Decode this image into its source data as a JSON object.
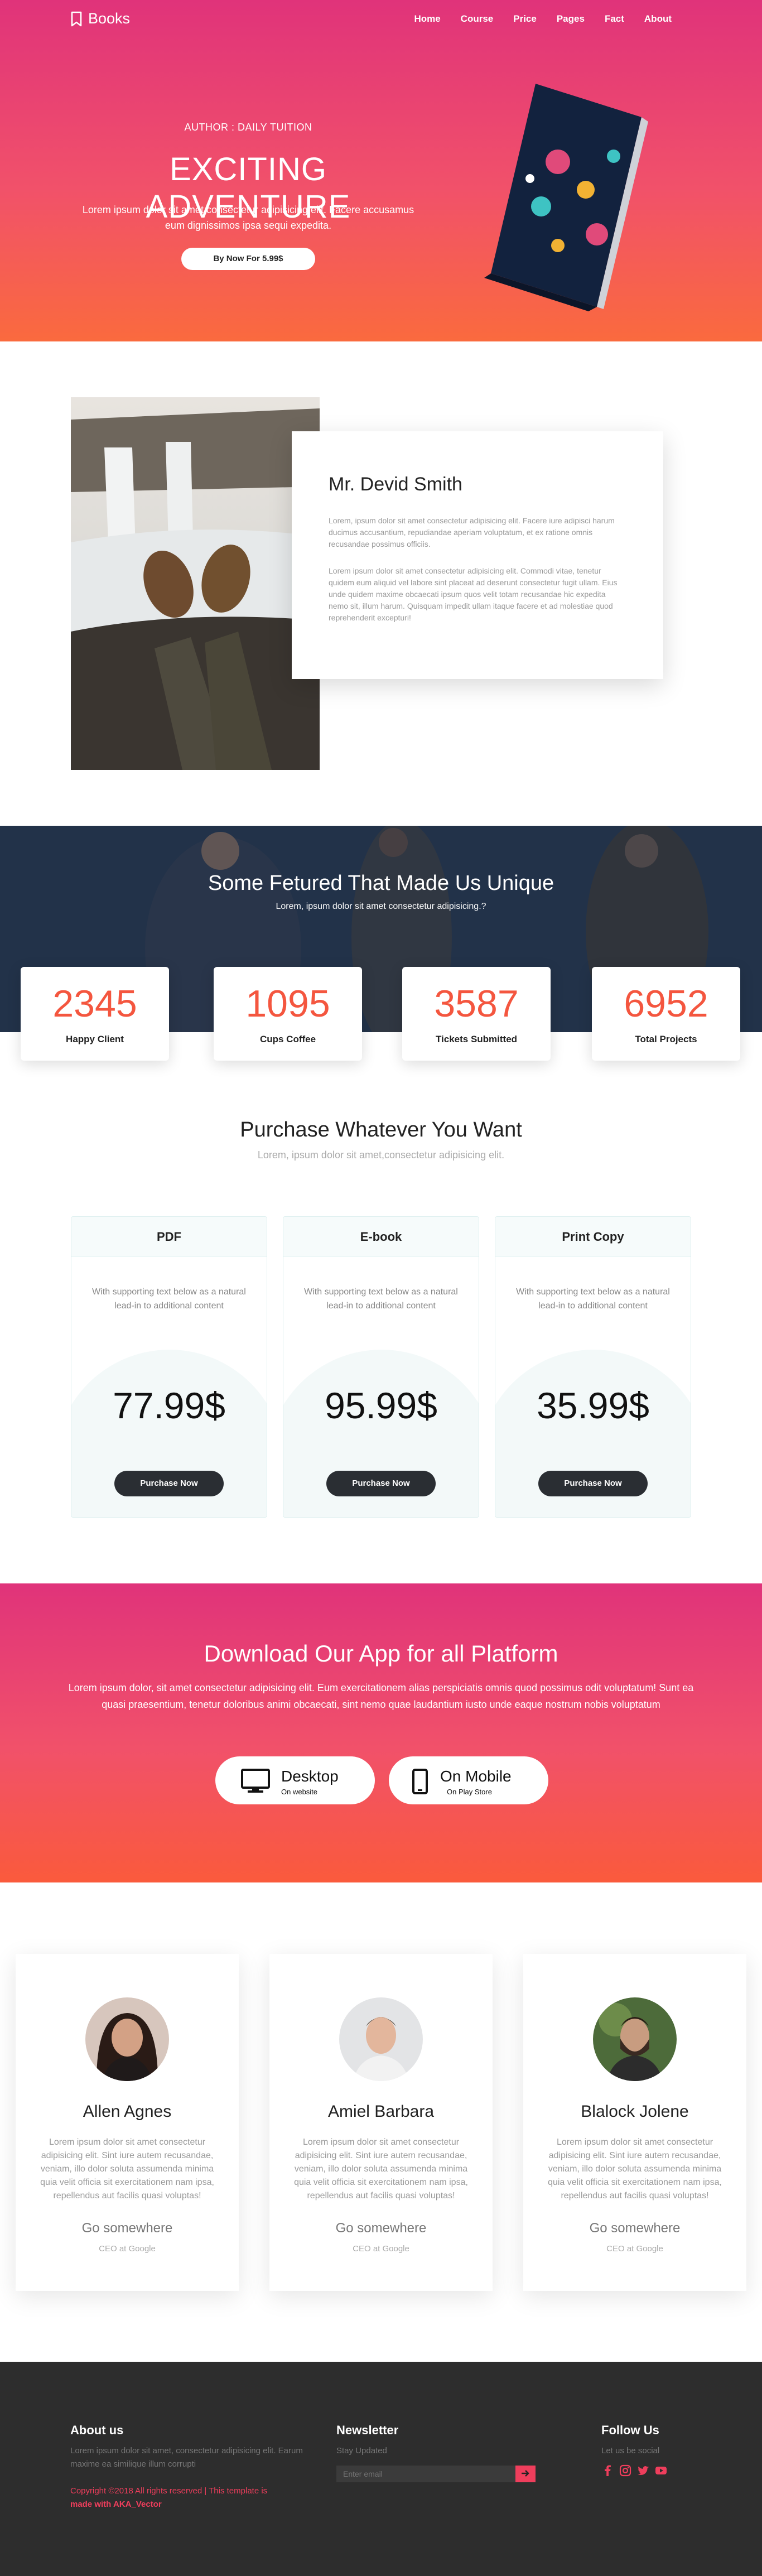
{
  "nav": {
    "brand": "Books",
    "items": [
      "Home",
      "Course",
      "Price",
      "Pages",
      "Fact",
      "About"
    ]
  },
  "hero": {
    "author": "AUTHOR : DAILY TUITION",
    "title": "EXCITING ADVENTURE",
    "text": "Lorem ipsum dolor sit amet consectetur adipisicing elit. Facere accusamus eum dignissimos ipsa sequi expedita.",
    "button": "By Now For 5.99$"
  },
  "profile": {
    "name": "Mr. Devid Smith",
    "para1": "Lorem, ipsum dolor sit amet consectetur adipisicing elit. Facere iure adipisci harum ducimus accusantium, repudiandae aperiam voluptatum, et ex ratione omnis recusandae possimus officiis.",
    "para2": "Lorem ipsum dolor sit amet consectetur adipisicing elit. Commodi vitae, tenetur quidem eum aliquid vel labore sint placeat ad deserunt consectetur fugit ullam. Eius unde quidem maxime obcaecati ipsum quos velit totam recusandae hic expedita nemo sit, illum harum. Quisquam impedit ullam itaque facere et ad molestiae quod reprehenderit excepturi!"
  },
  "featured": {
    "title": "Some Fetured That Made Us Unique",
    "subtitle": "Lorem, ipsum dolor sit amet consectetur adipisicing.?",
    "stats": [
      {
        "value": "2345",
        "label": "Happy Client"
      },
      {
        "value": "1095",
        "label": "Cups Coffee"
      },
      {
        "value": "3587",
        "label": "Tickets Submitted"
      },
      {
        "value": "6952",
        "label": "Total Projects"
      }
    ]
  },
  "purchase": {
    "title": "Purchase Whatever You Want",
    "subtitle": "Lorem, ipsum dolor sit amet,consectetur adipisicing elit.",
    "plans": [
      {
        "name": "PDF",
        "desc": "With supporting text below as a natural lead-in to additional content",
        "price": "77.99$",
        "button": "Purchase Now"
      },
      {
        "name": "E-book",
        "desc": "With supporting text below as a natural lead-in to additional content",
        "price": "95.99$",
        "button": "Purchase Now"
      },
      {
        "name": "Print Copy",
        "desc": "With supporting text below as a natural lead-in to additional content",
        "price": "35.99$",
        "button": "Purchase Now"
      }
    ]
  },
  "app": {
    "title": "Download Our App for all Platform",
    "text": "Lorem ipsum dolor, sit amet consectetur adipisicing elit. Eum exercitationem alias perspiciatis omnis quod possimus odit voluptatum! Sunt ea quasi praesentium, tenetur doloribus animi obcaecati, sint nemo quae laudantium iusto unde eaque nostrum nobis voluptatum",
    "desktop": {
      "label": "Desktop",
      "sub": "On website"
    },
    "mobile": {
      "label": "On Mobile",
      "sub": "On Play Store"
    }
  },
  "team": [
    {
      "name": "Allen Agnes",
      "text": "Lorem ipsum dolor sit amet consectetur adipisicing elit. Sint iure autem recusandae, veniam, illo dolor soluta assumenda minima quia velit officia sit exercitationem nam ipsa, repellendus aut facilis quasi voluptas!",
      "link": "Go somewhere",
      "role": "CEO at Google"
    },
    {
      "name": "Amiel Barbara",
      "text": "Lorem ipsum dolor sit amet consectetur adipisicing elit. Sint iure autem recusandae, veniam, illo dolor soluta assumenda minima quia velit officia sit exercitationem nam ipsa, repellendus aut facilis quasi voluptas!",
      "link": "Go somewhere",
      "role": "CEO at Google"
    },
    {
      "name": "Blalock Jolene",
      "text": "Lorem ipsum dolor sit amet consectetur adipisicing elit. Sint iure autem recusandae, veniam, illo dolor soluta assumenda minima quia velit officia sit exercitationem nam ipsa, repellendus aut facilis quasi voluptas!",
      "link": "Go somewhere",
      "role": "CEO at Google"
    }
  ],
  "footer": {
    "about_title": "About us",
    "about_text": "Lorem ipsum dolor sit amet, consectetur adipisicing elit. Earum maxime ea similique illum corrupti",
    "copyright": "Copyright ©2018 All rights reserved | This template is",
    "made_with": "made with AKA_Vector",
    "newsletter_title": "Newsletter",
    "newsletter_text": "Stay Updated",
    "email_placeholder": "Enter email",
    "follow_title": "Follow Us",
    "follow_text": "Let us be social",
    "social_icons": [
      "facebook-icon",
      "instagram-icon",
      "twitter-icon",
      "youtube-icon"
    ]
  },
  "colors": {
    "accent": "#f4563f",
    "pink": "#e0337a",
    "orange": "#fa6a3e",
    "dark": "#2d2d2d"
  }
}
